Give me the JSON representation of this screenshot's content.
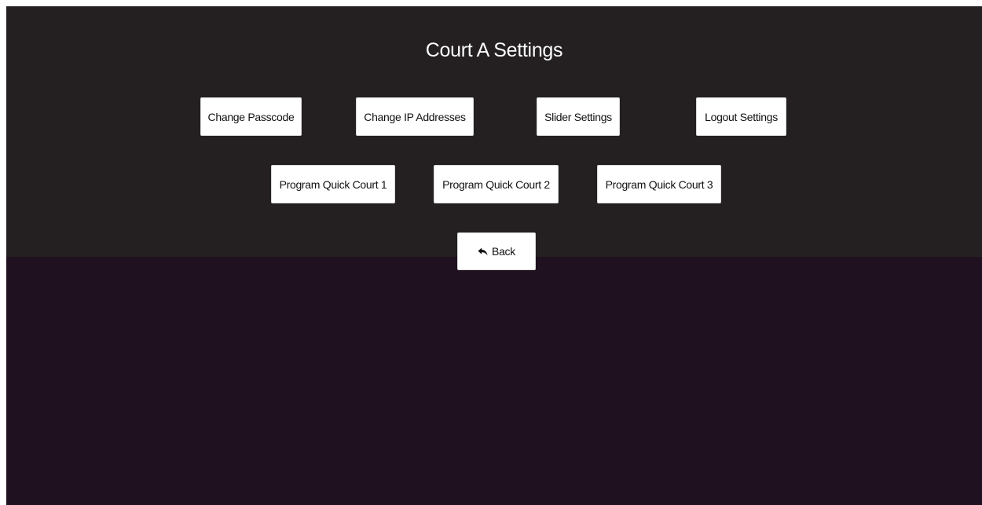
{
  "page": {
    "title": "Court A Settings"
  },
  "settings_row_1": [
    {
      "label": "Change Passcode"
    },
    {
      "label": "Change IP Addresses"
    },
    {
      "label": "Slider Settings"
    },
    {
      "label": "Logout Settings"
    }
  ],
  "settings_row_2": [
    {
      "label": "Program Quick Court 1"
    },
    {
      "label": "Program Quick Court 2"
    },
    {
      "label": "Program Quick Court 3"
    }
  ],
  "back": {
    "label": "Back",
    "icon": "reply-arrow-icon"
  },
  "colors": {
    "top_panel": "#242021",
    "bottom_panel": "#1f111f",
    "button_bg": "#ffffff",
    "title_text": "#ffffff"
  }
}
